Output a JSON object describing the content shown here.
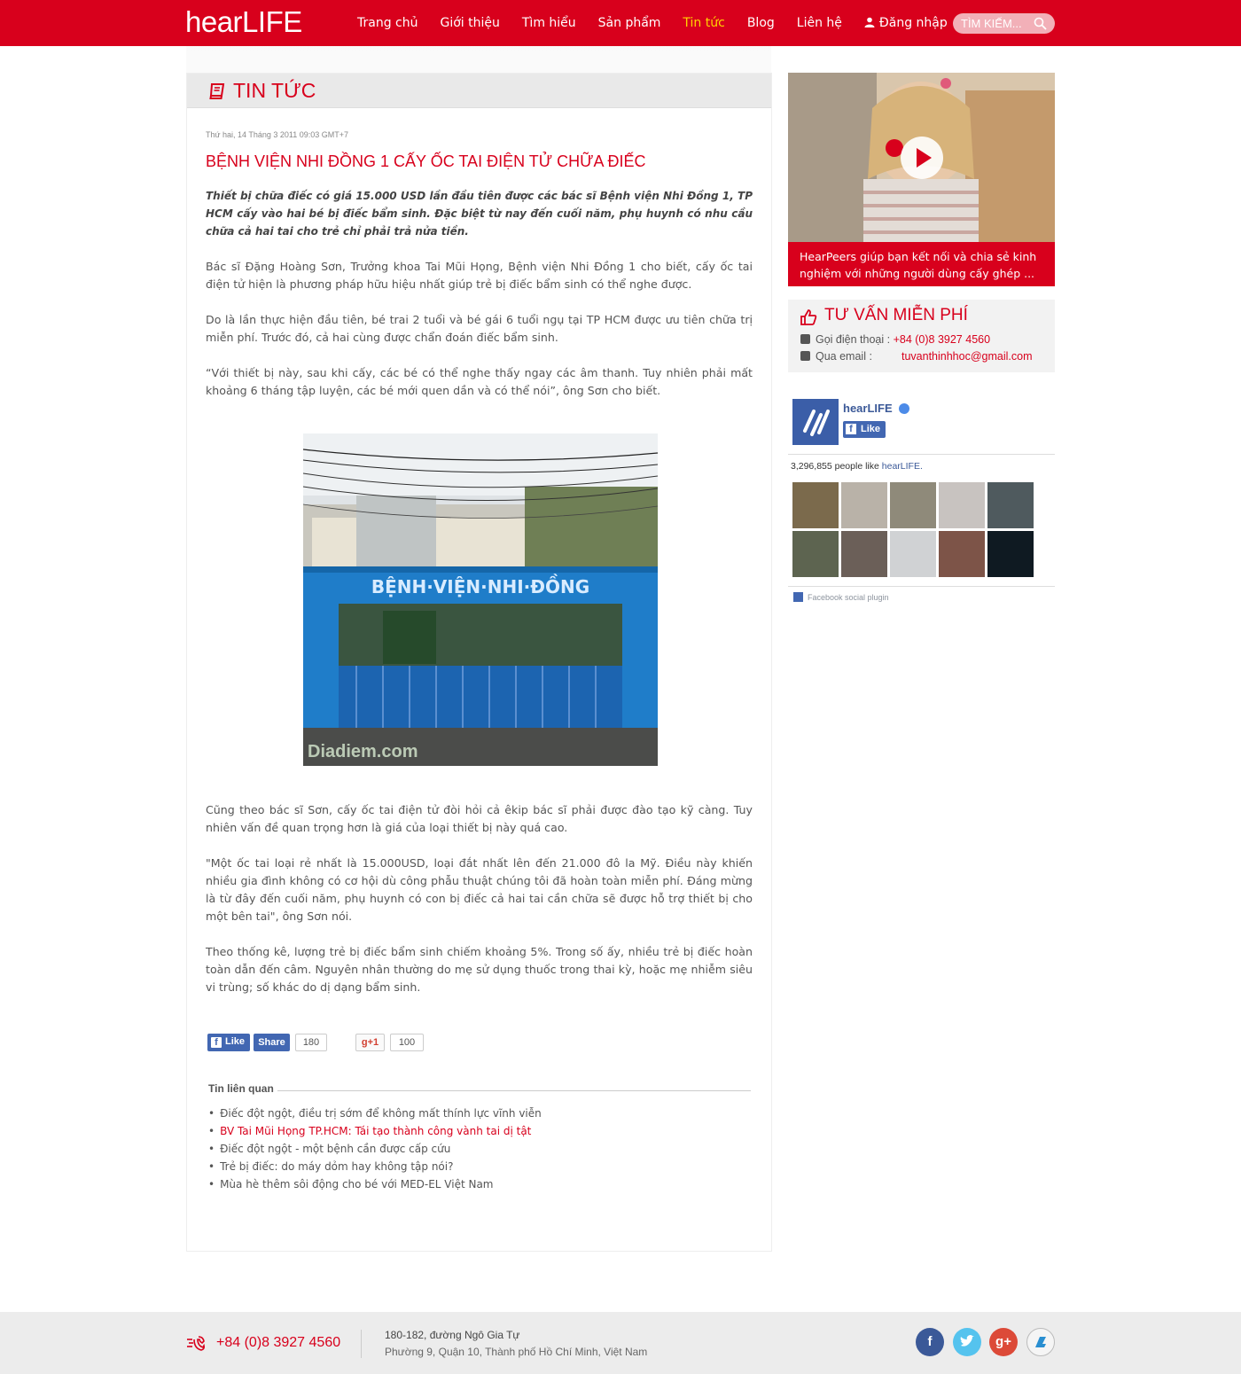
{
  "header": {
    "logo": "hearLIFE",
    "nav": [
      "Trang chủ",
      "Giới thiệu",
      "Tìm hiểu",
      "Sản phẩm",
      "Tin tức",
      "Blog",
      "Liên hệ"
    ],
    "login": "Đăng nhập",
    "search_placeholder": "TÌM KIẾM...",
    "active_nav": "Tin tức",
    "brand_color": "#d8001c",
    "active_color": "#ffd400"
  },
  "article": {
    "section_title": "TIN TỨC",
    "date": "Thứ hai, 14 Tháng 3 2011 09:03 GMT+7",
    "title": "BỆNH VIỆN NHI ĐỒNG 1 CẤY ỐC TAI ĐIỆN TỬ CHỮA ĐIẾC",
    "lead": "Thiết bị chữa điếc có giá 15.000 USD lần đầu tiên được các bác sĩ Bệnh viện Nhi Đồng 1, TP HCM cấy vào hai bé bị điếc bẩm sinh. Đặc biệt từ nay đến cuối năm, phụ huynh có nhu cầu chữa cả hai tai cho trẻ chỉ phải trả nửa tiền.",
    "paragraphs": [
      "Bác sĩ Đặng Hoàng Sơn, Trưởng khoa Tai Mũi Họng, Bệnh viện Nhi Đồng 1 cho biết, cấy ốc tai điện tử hiện là phương pháp hữu hiệu nhất giúp trẻ bị điếc bẩm sinh có thể nghe được.",
      "Do là lần thực hiện đầu tiên, bé trai 2 tuổi và bé gái 6 tuổi ngụ tại TP HCM được ưu tiên chữa trị miễn phí. Trước đó, cả hai cùng được chẩn đoán điếc bẩm sinh.",
      "“Với thiết bị này, sau khi cấy, các bé có thể nghe thấy ngay các âm thanh. Tuy nhiên phải mất khoảng 6 tháng tập luyện, các bé mới quen dần và có thể nói”, ông Sơn cho biết.",
      "Cũng theo bác sĩ Sơn, cấy ốc tai điện tử đòi hỏi cả êkip bác sĩ phải được đào tạo kỹ càng. Tuy nhiên vấn đề quan trọng hơn là giá của loại thiết bị này quá cao.",
      "\"Một ốc tai loại rẻ nhất là 15.000USD, loại đắt nhất lên đến 21.000 đô la Mỹ. Điều này khiến nhiều gia đình không có cơ hội dù công phẫu thuật chúng tôi đã hoàn toàn miễn phí. Đáng mừng là từ đây đến cuối năm, phụ huynh có con bị điếc cả hai tai cần chữa sẽ được hỗ trợ thiết bị cho một bên tai\", ông Sơn nói.",
      "Theo thống kê, lượng trẻ bị điếc bẩm sinh chiếm khoảng 5%. Trong số ấy, nhiều trẻ bị điếc hoàn toàn dẫn đến câm. Nguyên nhân thường do mẹ sử dụng thuốc trong thai kỳ, hoặc mẹ nhiễm siêu vi trùng; số khác do dị dạng bẩm sinh."
    ],
    "photo_sign_text": "BỆNH·VIỆN·NHI·ĐỒNG",
    "photo_watermark": "Diadiem.com"
  },
  "share": {
    "fb_like": "Like",
    "fb_share": "Share",
    "fb_count": "180",
    "gplus": "+1",
    "gplus_count": "100"
  },
  "related": {
    "title": "Tin liên quan",
    "items": [
      "Điếc đột ngột, điều trị sớm để không mất thính lực vĩnh viễn",
      "BV Tai Mũi Họng TP.HCM: Tái tạo thành công vành tai dị tật",
      "Điếc đột ngột - một bệnh cần được cấp cứu",
      "Trẻ bị điếc: do máy dỏm hay không tập nói?",
      "Mùa hè thêm sôi động cho bé với MED-EL Việt Nam"
    ]
  },
  "sidebar": {
    "video_caption": "HearPeers giúp bạn kết nối và chia sẻ kinh nghiệm với những người dùng cấy ghép ...",
    "consult_title": "TƯ VẤN MIỄN PHÍ",
    "phone_label": "Gọi điện thoại :",
    "phone_value": "+84 (0)8 3927 4560",
    "email_label": "Qua email :",
    "email_value": "tuvanthinhhoc@gmail.com",
    "fb_page_name": "hearLIFE",
    "fb_like": "Like",
    "fb_count_number": "3,296,855 people like",
    "fb_count_link": "hearLIFE.",
    "fb_plugin": "Facebook social plugin"
  },
  "footer": {
    "phone": "+84 (0)8 3927 4560",
    "address1": "180-182, đường Ngô Gia Tự",
    "address2": "Phường 9, Quận 10, Thành phố Hồ Chí Minh, Việt Nam",
    "social": [
      "facebook-icon",
      "twitter-icon",
      "google-plus-icon",
      "blog-icon"
    ]
  }
}
